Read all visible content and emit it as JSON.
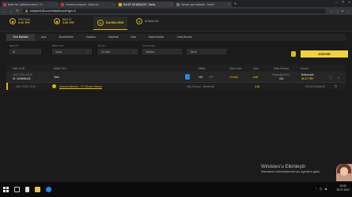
{
  "browser": {
    "tabs": [
      {
        "title": "Bahis Ner (@BahisYatirim) / Tv",
        "active": false,
        "fav": "red"
      },
      {
        "title": "Yardımcı hesaplar - Bahis Ne",
        "active": false,
        "fav": "red"
      },
      {
        "title": "BAHİS TAHMİNLERİ - Bahis",
        "active": true,
        "fav": "yellow"
      },
      {
        "title": "Tahmin spor bahisleri - Tercih",
        "active": false,
        "fav": "grey"
      }
    ],
    "new_tab": "+",
    "url": "bahisbet155.com/tr/dashboard?type=0",
    "window_controls": [
      "—",
      "❐",
      "✕"
    ]
  },
  "header": {
    "profile": {
      "label": "PROFİLİM",
      "value": "0.00 TRY"
    },
    "balance": {
      "label": "BAKİYE",
      "value": "0.00 TRY"
    },
    "history": {
      "label": "BAHİSLERİM"
    },
    "bonus": {
      "label": "BONUSLAR"
    }
  },
  "subtabs": [
    "Tüm Bahisler",
    "Açık",
    "Beraberlikte",
    "Kazandı",
    "Kaybetti",
    "İade",
    "Nakit Bozdur",
    "Canlı Bozdur"
  ],
  "filters": {
    "bet_id": {
      "label": "Bahis ID",
      "placeholder": "ID"
    },
    "bet_type": {
      "label": "Bahis Türü",
      "value": "Hepsi"
    },
    "period": {
      "label": "Dönem",
      "value": "24 Saat"
    },
    "date_range": {
      "label": "Tarih Aralığı",
      "from": "Tarihten",
      "to": "Tarihe"
    },
    "search": "GÖSTER"
  },
  "table": {
    "headers": [
      "Tarih ve ID",
      "Bahis Türü",
      "Miktar",
      "Olası Oran",
      "Oran",
      "Olası Kazanç",
      "Durum"
    ],
    "bet": {
      "date": "26.07.2021 18:30",
      "id": "ID: 1195898425",
      "type": "Tekli",
      "amount": "100",
      "currency": "TRY",
      "odds_type": "Ondalık",
      "odds": "2.43",
      "possible_win": "243",
      "possible_win_label": "Potansiyel Artış",
      "status": "Beklemede",
      "status_value": "94.17 TRY"
    },
    "selection": {
      "date": "26.07.2021 19:30",
      "match": "Adnoma Mestore - FC Wiener Viktoria",
      "market": "Maç Sonucu · Beraberlik",
      "odds": "2.43",
      "status": "HESAPLANMADI"
    }
  },
  "desktop": {
    "activate_title": "Windows'u Etkinleştir",
    "activate_sub": "Windows'u etkinleştirmek için Ayarlar'a gidin."
  },
  "taskbar": {
    "time": "20:52",
    "date": "26.07.2021"
  }
}
